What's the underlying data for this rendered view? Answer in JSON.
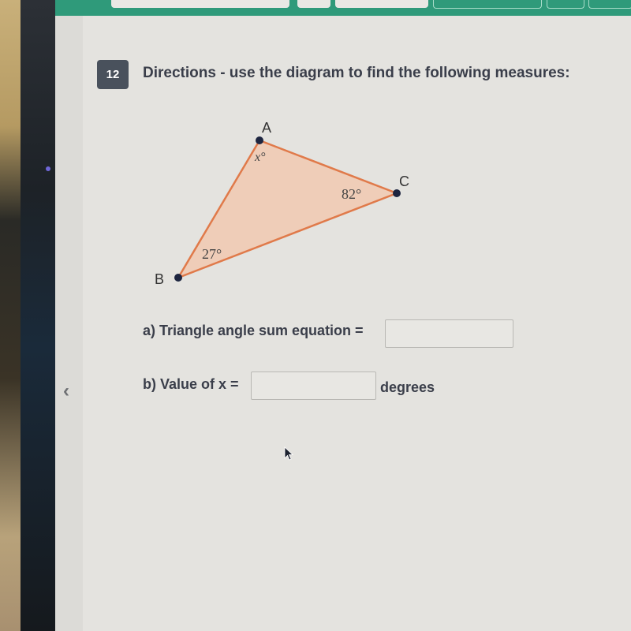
{
  "toolbar": {
    "accent_color": "#2f9a7a"
  },
  "question": {
    "number": "12",
    "directions": "Directions - use the diagram to find the following measures:"
  },
  "diagram": {
    "vertices": {
      "A": "A",
      "B": "B",
      "C": "C"
    },
    "angles": {
      "A": "x°",
      "B": "27°",
      "C": "82°"
    },
    "fill_color": "#efcdb8",
    "stroke_color": "#e07a4a"
  },
  "parts": {
    "a": {
      "label": "a) Triangle angle sum equation =",
      "value": "",
      "placeholder": ""
    },
    "b": {
      "label": "b) Value of x =",
      "value": "",
      "placeholder": "",
      "suffix": "degrees"
    }
  },
  "nav": {
    "prev_icon": "‹"
  }
}
